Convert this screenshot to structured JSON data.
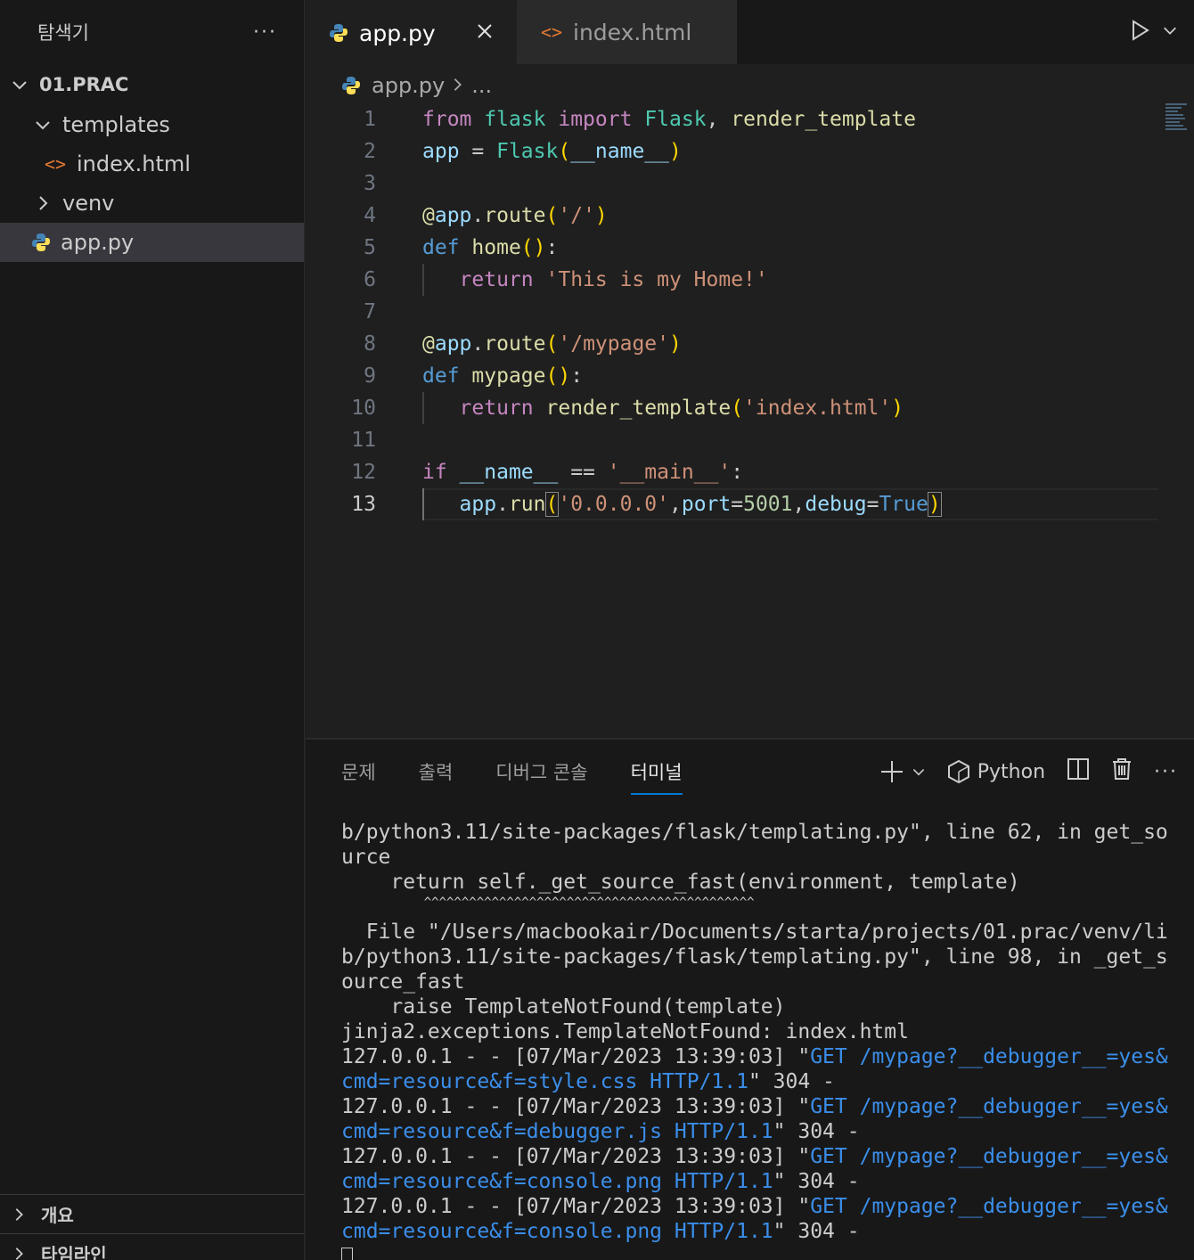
{
  "sidebar": {
    "title": "탐색기",
    "more": "···",
    "root": "01.PRAC",
    "items": [
      {
        "label": "templates"
      },
      {
        "label": "index.html"
      },
      {
        "label": "venv"
      },
      {
        "label": "app.py"
      }
    ],
    "sections": [
      {
        "label": "개요"
      },
      {
        "label": "타임라인"
      }
    ]
  },
  "tabs": [
    {
      "label": "app.py",
      "active": true
    },
    {
      "label": "index.html",
      "active": false
    }
  ],
  "breadcrumb": {
    "file": "app.py",
    "rest": "..."
  },
  "code": {
    "line_numbers": [
      "1",
      "2",
      "3",
      "4",
      "5",
      "6",
      "7",
      "8",
      "9",
      "10",
      "11",
      "12",
      "13"
    ],
    "current_line": 13
  },
  "panel": {
    "tabs": [
      "문제",
      "출력",
      "디버그 콘솔",
      "터미널"
    ],
    "active_tab": "터미널",
    "shell": "Python"
  },
  "terminal": {
    "lines": [
      "b/python3.11/site-packages/flask/templating.py\", line 62, in get_so",
      "urce",
      "    return self._get_source_fast(environment, template)",
      "           ^^^^^^^^^^^^^^^^^^^^^^^^^^^^^^^^^^^^^^^^^^^^",
      "  File \"/Users/macbookair/Documents/starta/projects/01.prac/venv/li",
      "b/python3.11/site-packages/flask/templating.py\", line 98, in _get_s",
      "ource_fast",
      "    raise TemplateNotFound(template)",
      "jinja2.exceptions.TemplateNotFound: index.html"
    ],
    "requests": [
      {
        "prefix": "127.0.0.1 - - [07/Mar/2023 13:39:03] \"",
        "method_path": "GET /mypage?__debugger__=yes&",
        "cont": "cmd=resource&f=style.css HTTP/1.1",
        "suffix": "\" 304 -"
      },
      {
        "prefix": "127.0.0.1 - - [07/Mar/2023 13:39:03] \"",
        "method_path": "GET /mypage?__debugger__=yes&",
        "cont": "cmd=resource&f=debugger.js HTTP/1.1",
        "suffix": "\" 304 -"
      },
      {
        "prefix": "127.0.0.1 - - [07/Mar/2023 13:39:03] \"",
        "method_path": "GET /mypage?__debugger__=yes&",
        "cont": "cmd=resource&f=console.png HTTP/1.1",
        "suffix": "\" 304 -"
      },
      {
        "prefix": "127.0.0.1 - - [07/Mar/2023 13:39:03] \"",
        "method_path": "GET /mypage?__debugger__=yes&",
        "cont": "cmd=resource&f=console.png HTTP/1.1",
        "suffix": "\" 304 -"
      }
    ]
  }
}
